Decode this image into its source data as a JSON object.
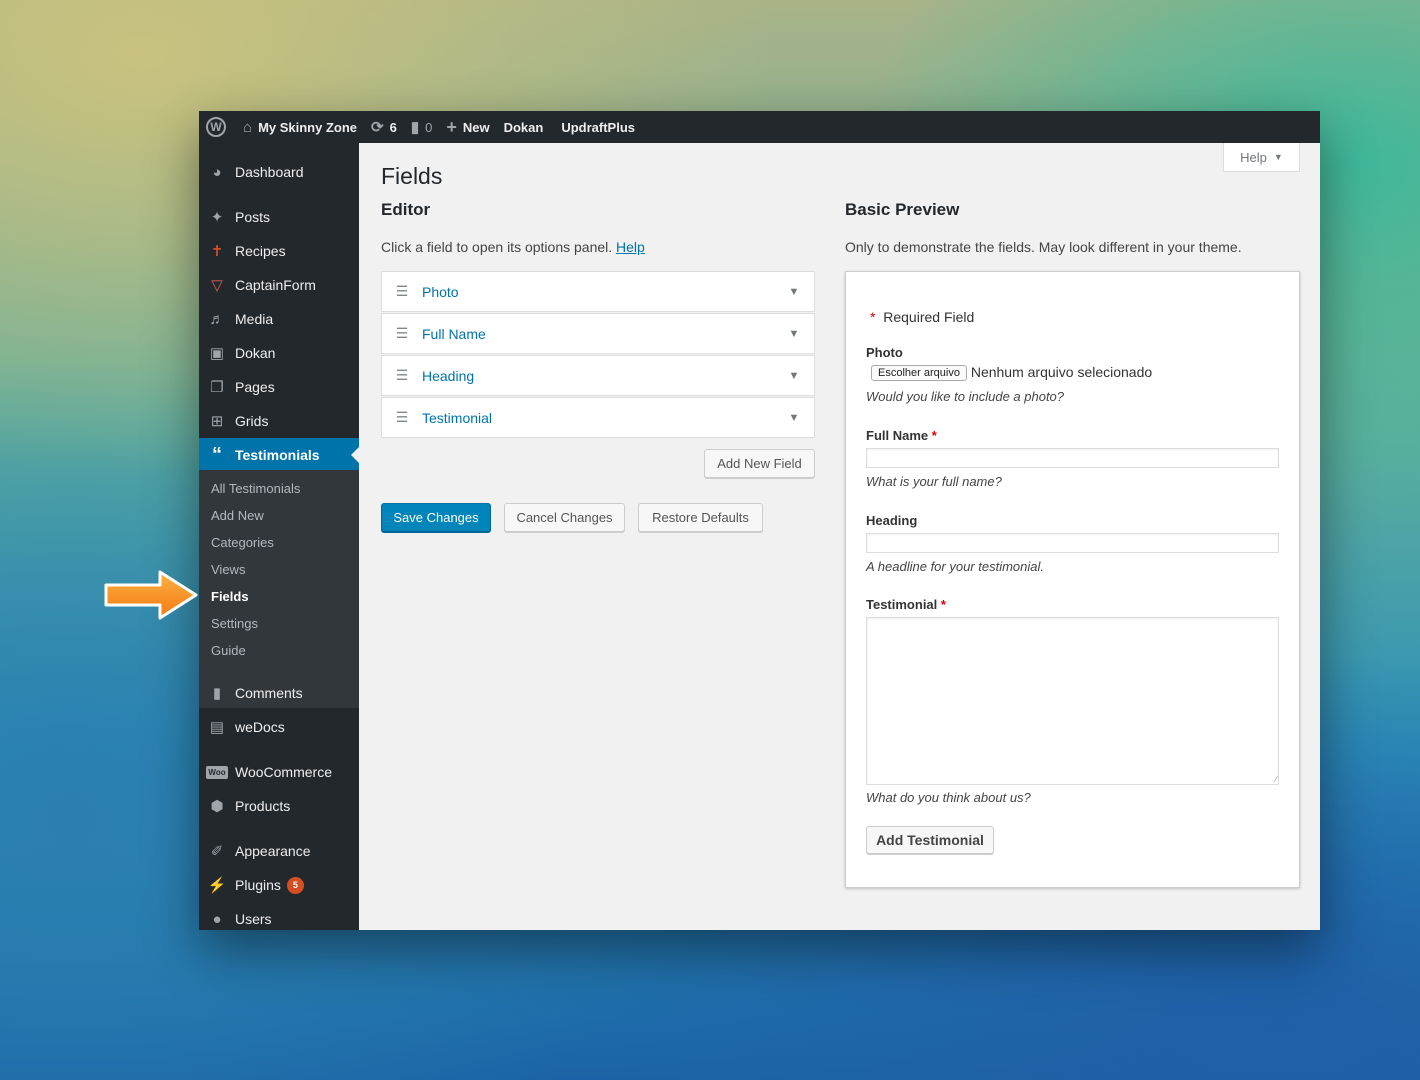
{
  "admin_bar": {
    "site_name": "My Skinny Zone",
    "updates_count": "6",
    "comments_count": "0",
    "new_label": "New",
    "items": [
      "Dokan",
      "UpdraftPlus"
    ]
  },
  "sidebar": {
    "items": [
      {
        "label": "Dashboard",
        "icon": "dashboard-icon"
      },
      {
        "label": "Posts",
        "icon": "pin-icon"
      },
      {
        "label": "Recipes",
        "icon": "recipes-icon"
      },
      {
        "label": "CaptainForm",
        "icon": "captainform-icon"
      },
      {
        "label": "Media",
        "icon": "media-icon"
      },
      {
        "label": "Dokan",
        "icon": "dokan-icon"
      },
      {
        "label": "Pages",
        "icon": "pages-icon"
      },
      {
        "label": "Grids",
        "icon": "grid-icon"
      },
      {
        "label": "Testimonials",
        "icon": "quote-icon"
      },
      {
        "label": "Comments",
        "icon": "comment-icon"
      },
      {
        "label": "weDocs",
        "icon": "docs-icon"
      },
      {
        "label": "WooCommerce",
        "icon": "woo-icon"
      },
      {
        "label": "Products",
        "icon": "box-icon"
      },
      {
        "label": "Appearance",
        "icon": "brush-icon"
      },
      {
        "label": "Plugins",
        "icon": "plugin-icon",
        "badge": "5"
      },
      {
        "label": "Users",
        "icon": "user-icon"
      }
    ],
    "submenu": [
      "All Testimonials",
      "Add New",
      "Categories",
      "Views",
      "Fields",
      "Settings",
      "Guide"
    ],
    "current_submenu": "Fields"
  },
  "help_tab": "Help",
  "page": {
    "title": "Fields",
    "editor_heading": "Editor",
    "editor_desc": "Click a field to open its options panel.",
    "editor_help_link": "Help",
    "fields": [
      "Photo",
      "Full Name",
      "Heading",
      "Testimonial"
    ],
    "add_field_button": "Add New Field",
    "save_button": "Save Changes",
    "cancel_button": "Cancel Changes",
    "restore_button": "Restore Defaults"
  },
  "preview": {
    "heading": "Basic Preview",
    "desc": "Only to demonstrate the fields. May look different in your theme.",
    "required_note": "Required Field",
    "photo_label": "Photo",
    "file_button": "Escolher arquivo",
    "file_status": "Nenhum arquivo selecionado",
    "photo_hint": "Would you like to include a photo?",
    "fullname_label": "Full Name",
    "fullname_hint": "What is your full name?",
    "heading_label": "Heading",
    "heading_hint": "A headline for your testimonial.",
    "testimonial_label": "Testimonial",
    "testimonial_hint": "What do you think about us?",
    "submit_button": "Add Testimonial"
  },
  "colors": {
    "admin_bar": "#23282d",
    "active_menu": "#0073aa",
    "primary_button": "#0085ba",
    "arrow": "#f7941d"
  }
}
